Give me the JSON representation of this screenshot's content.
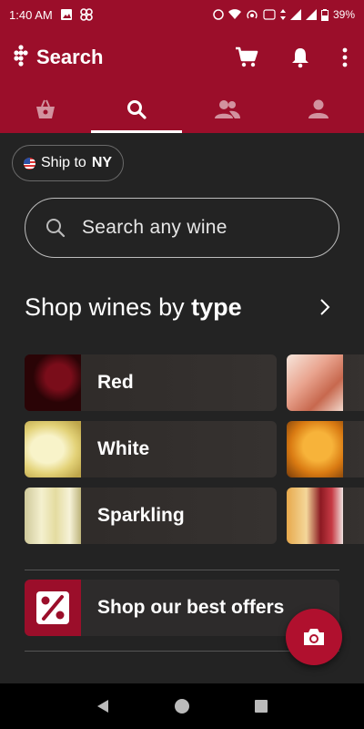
{
  "status_bar": {
    "time": "1:40 AM",
    "battery": "39%"
  },
  "app_bar": {
    "title": "Search"
  },
  "tabs": [
    {
      "name": "shop",
      "icon": "shopping-bag-icon"
    },
    {
      "name": "search",
      "icon": "search-icon",
      "active": true
    },
    {
      "name": "community",
      "icon": "people-icon"
    },
    {
      "name": "profile",
      "icon": "person-icon"
    }
  ],
  "ship": {
    "prefix": "Ship to",
    "state": "NY"
  },
  "search": {
    "placeholder": "Search any wine"
  },
  "shop_section": {
    "title_prefix": "Shop wines by",
    "title_bold": "type"
  },
  "wine_types": [
    "Red",
    "White",
    "Sparkling"
  ],
  "offers": {
    "label": "Shop our best offers"
  },
  "colors": {
    "brand": "#9b0e2a",
    "background": "#232323",
    "fab": "#b0102e"
  }
}
